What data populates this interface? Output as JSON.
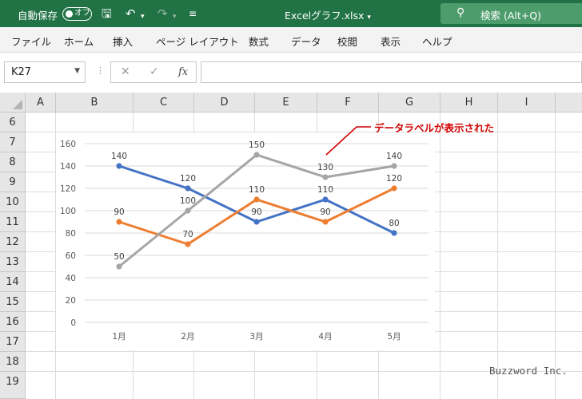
{
  "titlebar": {
    "autosave_label": "自動保存",
    "toggle_label": "オフ",
    "filename": "Excelグラフ.xlsx",
    "search_placeholder": "検索 (Alt+Q)"
  },
  "ribbon": {
    "tabs": [
      "ファイル",
      "ホーム",
      "挿入",
      "ページ レイアウト",
      "数式",
      "データ",
      "校閲",
      "表示",
      "ヘルプ"
    ]
  },
  "formula_bar": {
    "name_box": "K27",
    "fx": "fx",
    "formula": ""
  },
  "grid": {
    "columns": [
      "A",
      "B",
      "C",
      "D",
      "E",
      "F",
      "G",
      "H",
      "I"
    ],
    "rows": [
      "6",
      "7",
      "8",
      "9",
      "10",
      "11",
      "12",
      "13",
      "14",
      "15",
      "16",
      "17",
      "18",
      "19"
    ]
  },
  "chart_data": {
    "type": "line",
    "categories": [
      "1月",
      "2月",
      "3月",
      "4月",
      "5月"
    ],
    "ylim": [
      0,
      160
    ],
    "yticks": [
      "0",
      "20",
      "40",
      "60",
      "80",
      "100",
      "120",
      "140",
      "160"
    ],
    "gridlines": true,
    "series": [
      {
        "values": [
          140,
          120,
          90,
          110,
          80
        ],
        "color": "#4472c4"
      },
      {
        "values": [
          90,
          70,
          110,
          90,
          120
        ],
        "color": "#ed7d31"
      },
      {
        "values": [
          50,
          100,
          150,
          130,
          140
        ],
        "color": "#a5a5a5"
      }
    ]
  },
  "callout": {
    "text": "データラベルが表示された",
    "color": "#d00000"
  },
  "watermark": "Buzzword Inc."
}
